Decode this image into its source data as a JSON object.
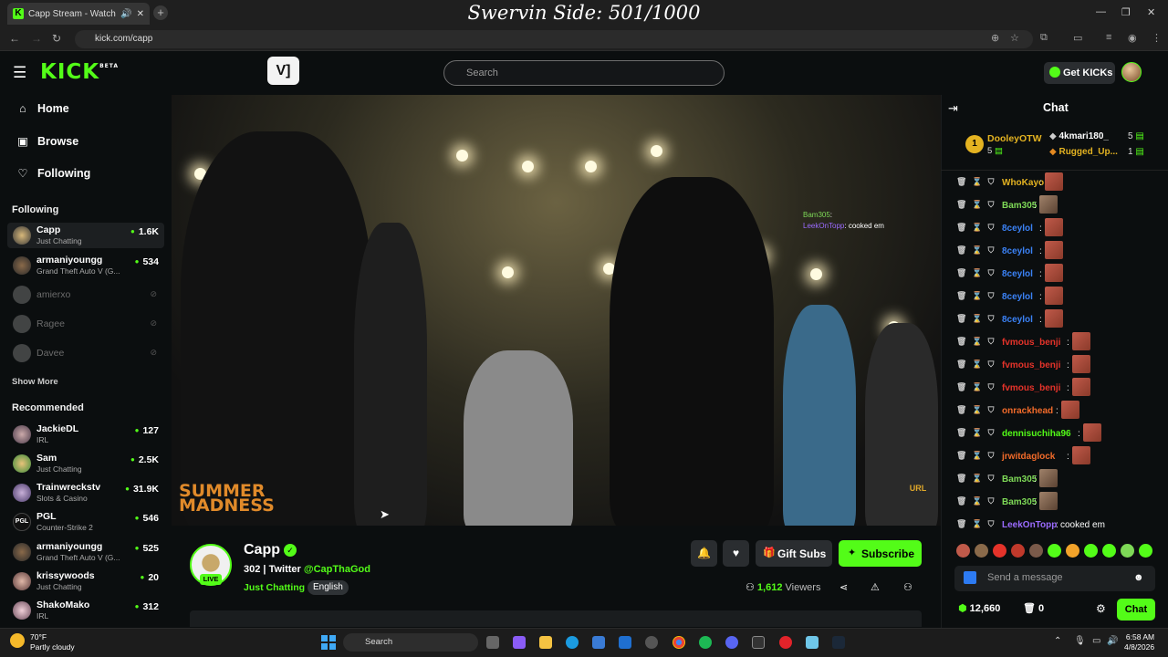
{
  "browser": {
    "tab_title": "Capp Stream - Watch Live o",
    "url": "kick.com/capp",
    "overlay_text": "Swervin Side: 501/1000"
  },
  "header": {
    "logo": "KICK",
    "logo_sup": "BETA",
    "search_placeholder": "Search",
    "get_kicks_label": "Get KICKs"
  },
  "sidebar": {
    "nav": [
      {
        "label": "Home",
        "icon": "home-icon"
      },
      {
        "label": "Browse",
        "icon": "browse-icon"
      },
      {
        "label": "Following",
        "icon": "heart-icon"
      }
    ],
    "following_title": "Following",
    "following": [
      {
        "name": "Capp",
        "category": "Just Chatting",
        "viewers": "1.6K",
        "live": true
      },
      {
        "name": "armaniyoungg",
        "category": "Grand Theft Auto V (G...",
        "viewers": "534",
        "live": true
      },
      {
        "name": "amierxo",
        "live": false
      },
      {
        "name": "Ragee",
        "live": false
      },
      {
        "name": "Davee",
        "live": false
      }
    ],
    "show_more": "Show More",
    "recommended_title": "Recommended",
    "recommended": [
      {
        "name": "JackieDL",
        "category": "IRL",
        "viewers": "127"
      },
      {
        "name": "Sam",
        "category": "Just Chatting",
        "viewers": "2.5K"
      },
      {
        "name": "Trainwreckstv",
        "category": "Slots & Casino",
        "viewers": "31.9K"
      },
      {
        "name": "PGL",
        "category": "Counter-Strike 2",
        "viewers": "546"
      },
      {
        "name": "armaniyoungg",
        "category": "Grand Theft Auto V (G...",
        "viewers": "525"
      },
      {
        "name": "krissywoods",
        "category": "Just Chatting",
        "viewers": "20"
      },
      {
        "name": "ShakoMako",
        "category": "IRL",
        "viewers": "312"
      }
    ]
  },
  "video": {
    "brand_left": "SUMMER MADNESS",
    "brand_right": "URL",
    "chat_overlay": [
      {
        "user": "Bam305",
        "msg": ": "
      },
      {
        "user": "LeekOnTopp",
        "msg": ": cooked em"
      }
    ]
  },
  "channel": {
    "name": "Capp",
    "live_label": "LIVE",
    "followers": "302",
    "twitter_prefix": "Twitter",
    "twitter_handle": "@CapThaGod",
    "category": "Just Chatting",
    "language": "English",
    "gift_subs_label": "Gift Subs",
    "subscribe_label": "Subscribe",
    "viewers_count": "1,612",
    "viewers_label": "Viewers"
  },
  "chat": {
    "title": "Chat",
    "leaderboard": {
      "first": {
        "rank": "1",
        "name": "DooleyOTW",
        "count": "5"
      },
      "others": [
        {
          "name": "4kmari180_",
          "count": "5"
        },
        {
          "name": "Rugged_Up...",
          "count": "1"
        }
      ]
    },
    "messages": [
      {
        "user": "WhoKayo",
        "color": "#e4b321",
        "type": "emote",
        "text": ""
      },
      {
        "user": "Bam305",
        "color": "#7ed957",
        "type": "face",
        "text": ""
      },
      {
        "user": "8ceylol",
        "color": "#3b82f6",
        "type": "emote",
        "text": ""
      },
      {
        "user": "8ceylol",
        "color": "#3b82f6",
        "type": "emote",
        "text": ""
      },
      {
        "user": "8ceylol",
        "color": "#3b82f6",
        "type": "emote",
        "text": ""
      },
      {
        "user": "8ceylol",
        "color": "#3b82f6",
        "type": "emote",
        "text": ""
      },
      {
        "user": "8ceylol",
        "color": "#3b82f6",
        "type": "emote",
        "text": ""
      },
      {
        "user": "fvmous_benji",
        "color": "#e5332a",
        "type": "emote",
        "text": ""
      },
      {
        "user": "fvmous_benji",
        "color": "#e5332a",
        "type": "emote",
        "text": ""
      },
      {
        "user": "fvmous_benji",
        "color": "#e5332a",
        "type": "emote",
        "text": ""
      },
      {
        "user": "onrackhead",
        "color": "#f26b2a",
        "type": "emote",
        "text": ""
      },
      {
        "user": "dennisuchiha96",
        "color": "#53fc18",
        "type": "emote",
        "text": ""
      },
      {
        "user": "jrwitdaglock",
        "color": "#f26b2a",
        "type": "emote",
        "text": ""
      },
      {
        "user": "Bam305",
        "color": "#7ed957",
        "type": "face",
        "text": ""
      },
      {
        "user": "Bam305",
        "color": "#7ed957",
        "type": "face",
        "text": ""
      },
      {
        "user": "LeekOnTopp",
        "color": "#9b6bff",
        "type": "text",
        "text": "cooked em"
      }
    ],
    "input_placeholder": "Send a message",
    "points": "12,660",
    "drops": "0",
    "chat_button": "Chat"
  },
  "taskbar": {
    "temperature": "70°F",
    "weather": "Partly cloudy",
    "search": "Search",
    "time": "6:58 AM",
    "date": "4/8/2026"
  }
}
